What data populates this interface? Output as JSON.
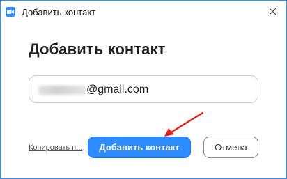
{
  "window": {
    "title": "Добавить контакт",
    "app_icon": "zoom-camera-icon",
    "close_icon": "close-icon",
    "close_glyph": "✕"
  },
  "dialog": {
    "heading": "Добавить контакт",
    "email": {
      "obscured_prefix": "blurred-text",
      "visible_value": "@gmail.com"
    },
    "copy_link": "Копировать п...",
    "add_button": "Добавить контакт",
    "cancel_button": "Отмена"
  },
  "annotation": {
    "arrow_color": "#e0231a",
    "arrow_icon": "red-arrow-annotation"
  },
  "colors": {
    "accent": "#2d8cff",
    "window_border": "#2d8cff",
    "heading_text": "#222222"
  }
}
